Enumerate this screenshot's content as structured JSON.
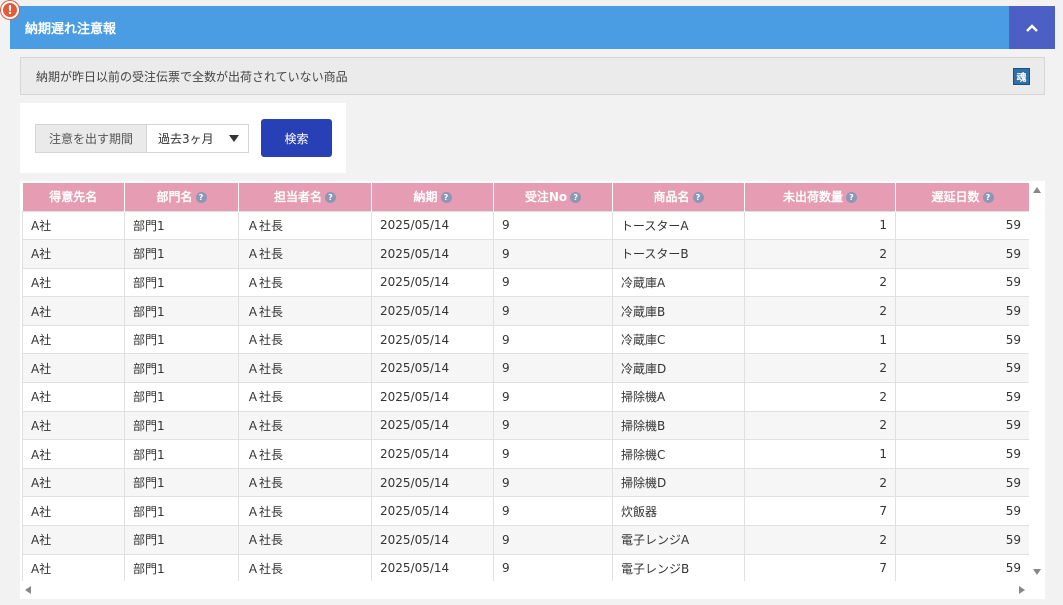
{
  "panel": {
    "title": "納期遅れ注意報",
    "description": "納期が昨日以前の受注伝票で全数が出荷されていない商品",
    "help_badge": "魂"
  },
  "search": {
    "period_label": "注意を出す期間",
    "period_value": "過去3ヶ月",
    "search_label": "検索"
  },
  "table": {
    "columns": [
      "得意先名",
      "部門名",
      "担当者名",
      "納期",
      "受注No",
      "商品名",
      "未出荷数量",
      "遅延日数"
    ],
    "rows": [
      [
        "A社",
        "部門1",
        "Ａ社長",
        "2025/05/14",
        "9",
        "トースターA",
        "1",
        "59"
      ],
      [
        "A社",
        "部門1",
        "Ａ社長",
        "2025/05/14",
        "9",
        "トースターB",
        "2",
        "59"
      ],
      [
        "A社",
        "部門1",
        "Ａ社長",
        "2025/05/14",
        "9",
        "冷蔵庫A",
        "2",
        "59"
      ],
      [
        "A社",
        "部門1",
        "Ａ社長",
        "2025/05/14",
        "9",
        "冷蔵庫B",
        "2",
        "59"
      ],
      [
        "A社",
        "部門1",
        "Ａ社長",
        "2025/05/14",
        "9",
        "冷蔵庫C",
        "1",
        "59"
      ],
      [
        "A社",
        "部門1",
        "Ａ社長",
        "2025/05/14",
        "9",
        "冷蔵庫D",
        "2",
        "59"
      ],
      [
        "A社",
        "部門1",
        "Ａ社長",
        "2025/05/14",
        "9",
        "掃除機A",
        "2",
        "59"
      ],
      [
        "A社",
        "部門1",
        "Ａ社長",
        "2025/05/14",
        "9",
        "掃除機B",
        "2",
        "59"
      ],
      [
        "A社",
        "部門1",
        "Ａ社長",
        "2025/05/14",
        "9",
        "掃除機C",
        "1",
        "59"
      ],
      [
        "A社",
        "部門1",
        "Ａ社長",
        "2025/05/14",
        "9",
        "掃除機D",
        "2",
        "59"
      ],
      [
        "A社",
        "部門1",
        "Ａ社長",
        "2025/05/14",
        "9",
        "炊飯器",
        "7",
        "59"
      ],
      [
        "A社",
        "部門1",
        "Ａ社長",
        "2025/05/14",
        "9",
        "電子レンジA",
        "2",
        "59"
      ],
      [
        "A社",
        "部門1",
        "Ａ社長",
        "2025/05/14",
        "9",
        "電子レンジB",
        "7",
        "59"
      ]
    ]
  },
  "colors": {
    "header_bar": "#4a9ce3",
    "collapse_button": "#4c5fc4",
    "search_button": "#2740b5",
    "table_header": "#e69cb3",
    "alert": "#e35a3a"
  }
}
